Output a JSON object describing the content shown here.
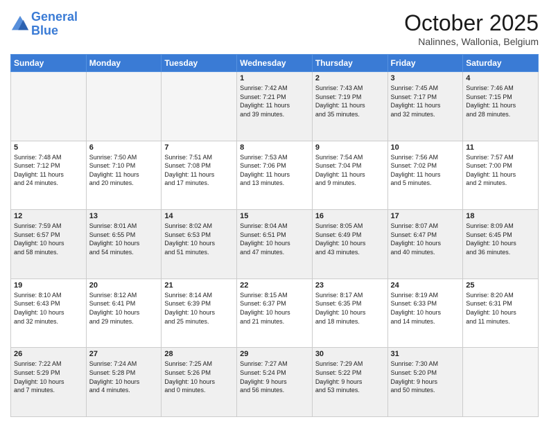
{
  "header": {
    "logo_line1": "General",
    "logo_line2": "Blue",
    "month": "October 2025",
    "location": "Nalinnes, Wallonia, Belgium"
  },
  "days_of_week": [
    "Sunday",
    "Monday",
    "Tuesday",
    "Wednesday",
    "Thursday",
    "Friday",
    "Saturday"
  ],
  "weeks": [
    [
      {
        "day": "",
        "info": ""
      },
      {
        "day": "",
        "info": ""
      },
      {
        "day": "",
        "info": ""
      },
      {
        "day": "1",
        "info": "Sunrise: 7:42 AM\nSunset: 7:21 PM\nDaylight: 11 hours\nand 39 minutes."
      },
      {
        "day": "2",
        "info": "Sunrise: 7:43 AM\nSunset: 7:19 PM\nDaylight: 11 hours\nand 35 minutes."
      },
      {
        "day": "3",
        "info": "Sunrise: 7:45 AM\nSunset: 7:17 PM\nDaylight: 11 hours\nand 32 minutes."
      },
      {
        "day": "4",
        "info": "Sunrise: 7:46 AM\nSunset: 7:15 PM\nDaylight: 11 hours\nand 28 minutes."
      }
    ],
    [
      {
        "day": "5",
        "info": "Sunrise: 7:48 AM\nSunset: 7:12 PM\nDaylight: 11 hours\nand 24 minutes."
      },
      {
        "day": "6",
        "info": "Sunrise: 7:50 AM\nSunset: 7:10 PM\nDaylight: 11 hours\nand 20 minutes."
      },
      {
        "day": "7",
        "info": "Sunrise: 7:51 AM\nSunset: 7:08 PM\nDaylight: 11 hours\nand 17 minutes."
      },
      {
        "day": "8",
        "info": "Sunrise: 7:53 AM\nSunset: 7:06 PM\nDaylight: 11 hours\nand 13 minutes."
      },
      {
        "day": "9",
        "info": "Sunrise: 7:54 AM\nSunset: 7:04 PM\nDaylight: 11 hours\nand 9 minutes."
      },
      {
        "day": "10",
        "info": "Sunrise: 7:56 AM\nSunset: 7:02 PM\nDaylight: 11 hours\nand 5 minutes."
      },
      {
        "day": "11",
        "info": "Sunrise: 7:57 AM\nSunset: 7:00 PM\nDaylight: 11 hours\nand 2 minutes."
      }
    ],
    [
      {
        "day": "12",
        "info": "Sunrise: 7:59 AM\nSunset: 6:57 PM\nDaylight: 10 hours\nand 58 minutes."
      },
      {
        "day": "13",
        "info": "Sunrise: 8:01 AM\nSunset: 6:55 PM\nDaylight: 10 hours\nand 54 minutes."
      },
      {
        "day": "14",
        "info": "Sunrise: 8:02 AM\nSunset: 6:53 PM\nDaylight: 10 hours\nand 51 minutes."
      },
      {
        "day": "15",
        "info": "Sunrise: 8:04 AM\nSunset: 6:51 PM\nDaylight: 10 hours\nand 47 minutes."
      },
      {
        "day": "16",
        "info": "Sunrise: 8:05 AM\nSunset: 6:49 PM\nDaylight: 10 hours\nand 43 minutes."
      },
      {
        "day": "17",
        "info": "Sunrise: 8:07 AM\nSunset: 6:47 PM\nDaylight: 10 hours\nand 40 minutes."
      },
      {
        "day": "18",
        "info": "Sunrise: 8:09 AM\nSunset: 6:45 PM\nDaylight: 10 hours\nand 36 minutes."
      }
    ],
    [
      {
        "day": "19",
        "info": "Sunrise: 8:10 AM\nSunset: 6:43 PM\nDaylight: 10 hours\nand 32 minutes."
      },
      {
        "day": "20",
        "info": "Sunrise: 8:12 AM\nSunset: 6:41 PM\nDaylight: 10 hours\nand 29 minutes."
      },
      {
        "day": "21",
        "info": "Sunrise: 8:14 AM\nSunset: 6:39 PM\nDaylight: 10 hours\nand 25 minutes."
      },
      {
        "day": "22",
        "info": "Sunrise: 8:15 AM\nSunset: 6:37 PM\nDaylight: 10 hours\nand 21 minutes."
      },
      {
        "day": "23",
        "info": "Sunrise: 8:17 AM\nSunset: 6:35 PM\nDaylight: 10 hours\nand 18 minutes."
      },
      {
        "day": "24",
        "info": "Sunrise: 8:19 AM\nSunset: 6:33 PM\nDaylight: 10 hours\nand 14 minutes."
      },
      {
        "day": "25",
        "info": "Sunrise: 8:20 AM\nSunset: 6:31 PM\nDaylight: 10 hours\nand 11 minutes."
      }
    ],
    [
      {
        "day": "26",
        "info": "Sunrise: 7:22 AM\nSunset: 5:29 PM\nDaylight: 10 hours\nand 7 minutes."
      },
      {
        "day": "27",
        "info": "Sunrise: 7:24 AM\nSunset: 5:28 PM\nDaylight: 10 hours\nand 4 minutes."
      },
      {
        "day": "28",
        "info": "Sunrise: 7:25 AM\nSunset: 5:26 PM\nDaylight: 10 hours\nand 0 minutes."
      },
      {
        "day": "29",
        "info": "Sunrise: 7:27 AM\nSunset: 5:24 PM\nDaylight: 9 hours\nand 56 minutes."
      },
      {
        "day": "30",
        "info": "Sunrise: 7:29 AM\nSunset: 5:22 PM\nDaylight: 9 hours\nand 53 minutes."
      },
      {
        "day": "31",
        "info": "Sunrise: 7:30 AM\nSunset: 5:20 PM\nDaylight: 9 hours\nand 50 minutes."
      },
      {
        "day": "",
        "info": ""
      }
    ]
  ]
}
